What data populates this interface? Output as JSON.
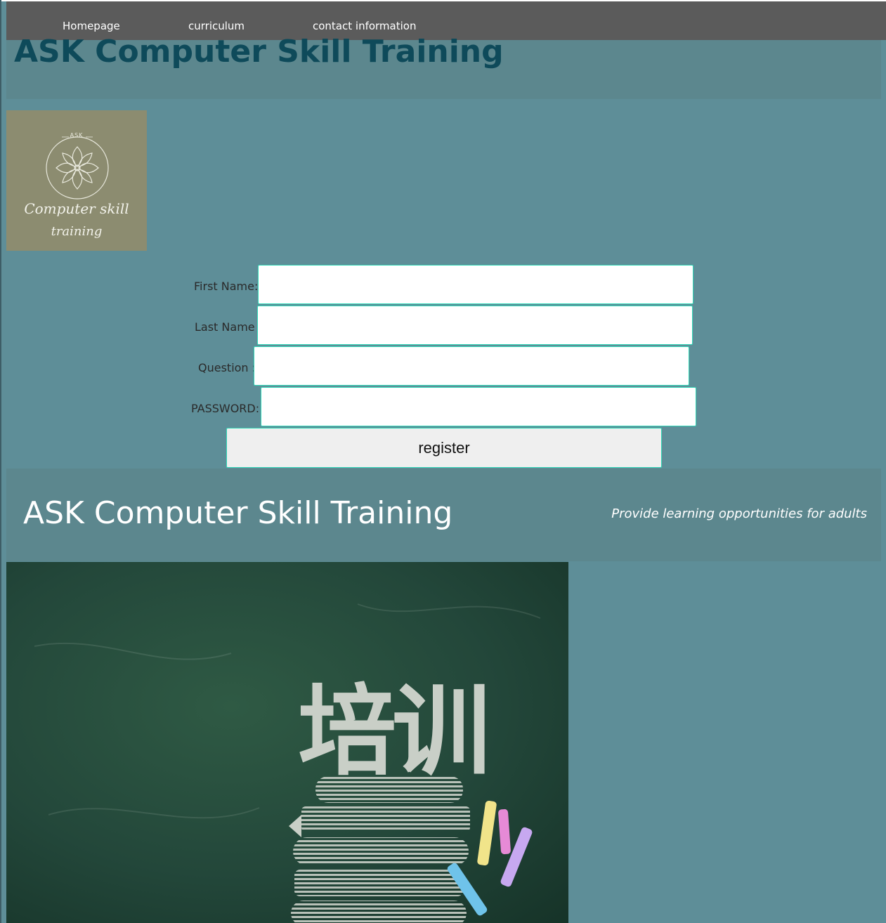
{
  "nav": {
    "items": [
      {
        "label": "Homepage"
      },
      {
        "label": "curriculum"
      },
      {
        "label": "contact information"
      }
    ]
  },
  "header": {
    "title": "ASK Computer Skill Training"
  },
  "logo": {
    "top_text": "ASK",
    "line1": "Computer skill",
    "line2": "training"
  },
  "form": {
    "first_name": {
      "label": "First Name:",
      "value": ""
    },
    "last_name": {
      "label": "Last Name :",
      "value": ""
    },
    "question": {
      "label": "Question :",
      "value": ""
    },
    "password": {
      "label": "PASSWORD:",
      "value": ""
    },
    "register_label": "register"
  },
  "footer": {
    "title": "ASK Computer Skill Training",
    "tagline": "Provide learning opportunities for adults"
  },
  "banner": {
    "chalk_text": "培训"
  },
  "colors": {
    "background": "#5e8e98",
    "nav": "#5b5b5b",
    "title": "#0e4a5a",
    "input_border": "#2fd6b6"
  }
}
